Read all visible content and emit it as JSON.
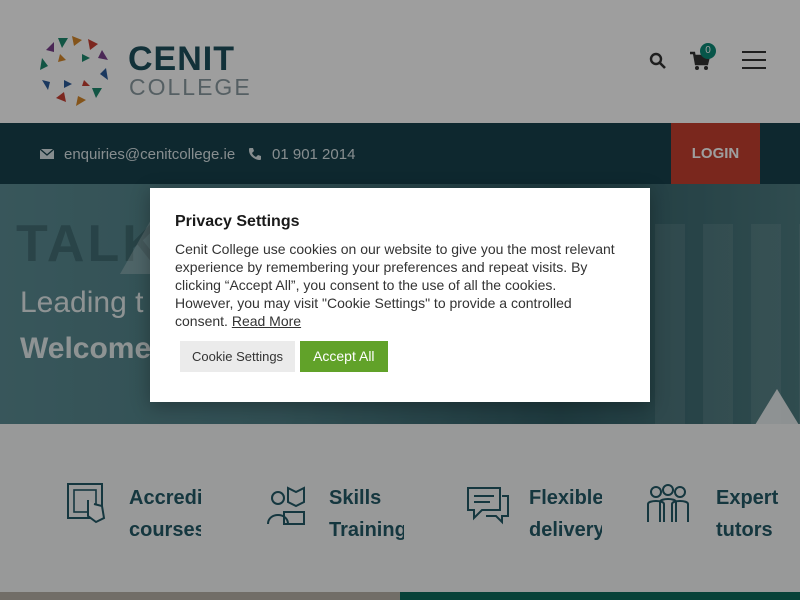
{
  "brand": {
    "word1": "CENIT",
    "word2": "COLLEGE"
  },
  "header": {
    "cart_count": "0"
  },
  "contact": {
    "email": "enquiries@cenitcollege.ie",
    "phone": "01 901 2014",
    "login_label": "LOGIN"
  },
  "hero": {
    "subtitle": "Leading t",
    "title": "Welcome"
  },
  "features": [
    {
      "line1": "Accredi",
      "line2": "courses"
    },
    {
      "line1": "Skills",
      "line2": "Training"
    },
    {
      "line1": "Flexible",
      "line2": "delivery"
    },
    {
      "line1": "Expert",
      "line2": "tutors"
    }
  ],
  "modal": {
    "title": "Privacy Settings",
    "body": "Cenit College use cookies on our website to give you the most relevant experience by remembering your preferences and repeat visits. By clicking “Accept All”, you consent to the use of all the cookies. However, you may visit \"Cookie Settings\" to provide a controlled consent.",
    "read_more": "Read More",
    "settings_label": "Cookie Settings",
    "accept_label": "Accept All"
  },
  "colors": {
    "teal_dark": "#18414c",
    "login_red": "#c5402f",
    "accept_green": "#61a229",
    "feature_text": "#235967"
  }
}
